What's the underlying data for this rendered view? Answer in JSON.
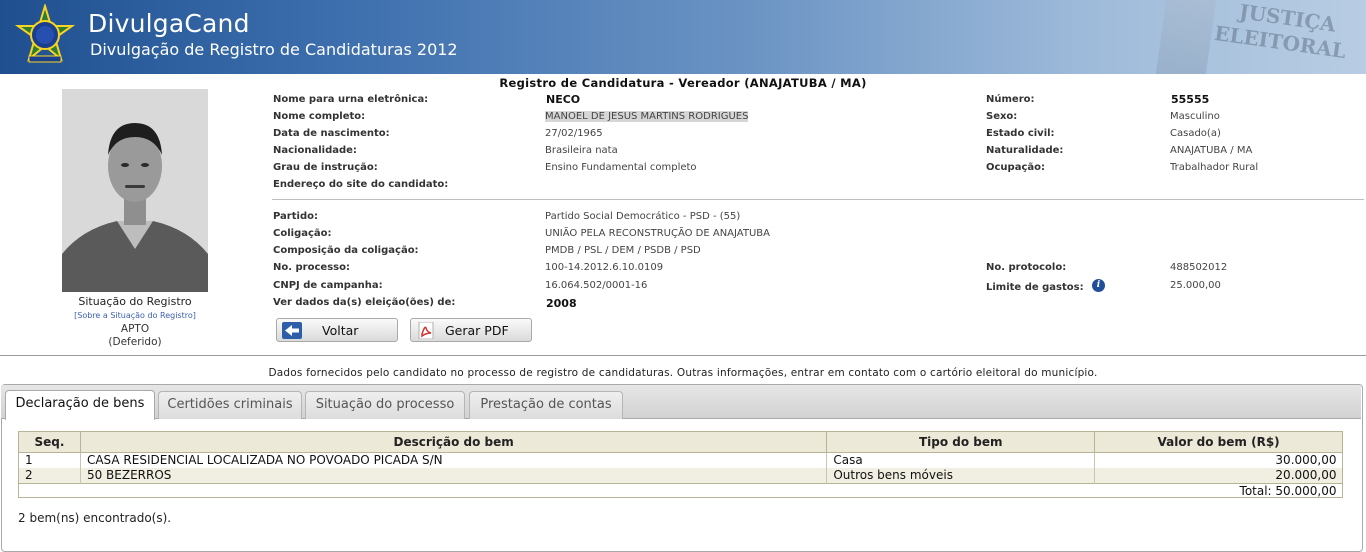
{
  "header": {
    "app_title": "DivulgaCand",
    "app_subtitle": "Divulgação de Registro de Candidaturas 2012",
    "je_line1": "JUSTIÇA",
    "je_line2": "ELEITORAL"
  },
  "record_title": "Registro de Candidatura - Vereador (ANAJATUBA / MA)",
  "registration": {
    "status_label": "Situação do Registro",
    "about_link": "[Sobre a Situação do Registro]",
    "status_value": "APTO",
    "status_detail": "(Deferido)"
  },
  "candidate": {
    "urn_name_label": "Nome para urna eletrônica:",
    "urn_name": "NECO",
    "full_name_label": "Nome completo:",
    "full_name": "MANOEL DE JESUS MARTINS RODRIGUES",
    "birth_label": "Data de nascimento:",
    "birth": "27/02/1965",
    "nationality_label": "Nacionalidade:",
    "nationality": "Brasileira nata",
    "education_label": "Grau de instrução:",
    "education": "Ensino Fundamental completo",
    "site_label": "Endereço do site do candidato:",
    "number_label": "Número:",
    "number": "55555",
    "sex_label": "Sexo:",
    "sex": "Masculino",
    "marital_label": "Estado civil:",
    "marital": "Casado(a)",
    "birthplace_label": "Naturalidade:",
    "birthplace": "ANAJATUBA / MA",
    "occupation_label": "Ocupação:",
    "occupation": "Trabalhador Rural"
  },
  "campaign": {
    "party_label": "Partido:",
    "party": "Partido Social Democrático -  PSD - (55)",
    "coalition_label": "Coligação:",
    "coalition": "UNIÃO PELA RECONSTRUÇÃO DE ANAJATUBA",
    "composition_label": "Composição da coligação:",
    "composition": "PMDB / PSL / DEM / PSDB / PSD",
    "process_label": "No. processo:",
    "process": "100-14.2012.6.10.0109",
    "cnpj_label": "CNPJ de campanha:",
    "cnpj": "16.064.502/0001-16",
    "elections_label": "Ver dados da(s) eleição(ões) de:",
    "elections": "2008",
    "protocol_label": "No. protocolo:",
    "protocol": "488502012",
    "spending_label": "Limite de gastos:",
    "spending": "25.000,00"
  },
  "buttons": {
    "back": "Voltar",
    "pdf": "Gerar PDF"
  },
  "notice": "Dados fornecidos pelo candidato no processo de registro de candidaturas.  Outras informações, entrar em contato com o cartório eleitoral do município.",
  "tabs": [
    {
      "label": "Declaração de bens",
      "active": true
    },
    {
      "label": "Certidões criminais",
      "active": false
    },
    {
      "label": "Situação do processo",
      "active": false
    },
    {
      "label": "Prestação de contas",
      "active": false
    }
  ],
  "assets": {
    "columns": [
      "Seq.",
      "Descrição do bem",
      "Tipo do bem",
      "Valor do bem (R$)"
    ],
    "rows": [
      {
        "seq": "1",
        "description": "CASA RESIDENCIAL LOCALIZADA NO POVOADO PICADA S/N",
        "type": "Casa",
        "value": "30.000,00"
      },
      {
        "seq": "2",
        "description": "50 BEZERROS",
        "type": "Outros bens móveis",
        "value": "20.000,00"
      }
    ],
    "total": "Total: 50.000,00",
    "found": "2 bem(ns) encontrado(s)."
  }
}
